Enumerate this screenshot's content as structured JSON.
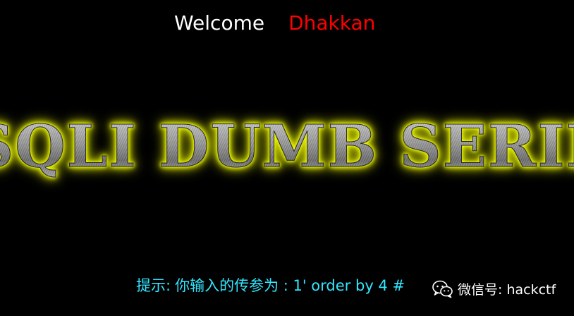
{
  "header": {
    "welcome": "Welcome",
    "user": "Dhakkan"
  },
  "banner": {
    "text": "SQLI DUMB SERIES",
    "glow_color": "#f5ff00"
  },
  "hint": {
    "label": "提示:",
    "value": "你输入的传参为 : 1' order by 4 #"
  },
  "watermark": {
    "icon": "wechat-icon",
    "text": "微信号: hackctf"
  },
  "colors": {
    "background": "#000000",
    "welcome": "#ffffff",
    "user": "#ff0000",
    "hint": "#33e6ff"
  }
}
